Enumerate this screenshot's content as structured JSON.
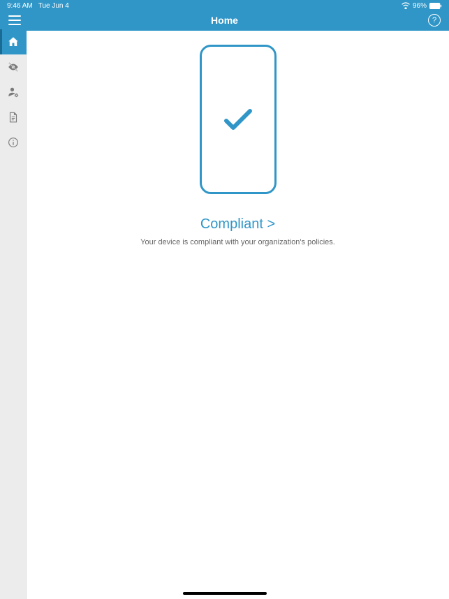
{
  "statusBar": {
    "time": "9:46 AM",
    "date": "Tue Jun 4",
    "battery": "96%"
  },
  "header": {
    "title": "Home",
    "helpSymbol": "?"
  },
  "sidebar": {
    "items": [
      {
        "name": "home",
        "active": true
      },
      {
        "name": "privacy",
        "active": false
      },
      {
        "name": "user-settings",
        "active": false
      },
      {
        "name": "document",
        "active": false
      },
      {
        "name": "info",
        "active": false
      }
    ]
  },
  "main": {
    "statusLabel": "Compliant >",
    "statusDescription": "Your device is compliant with your organization's policies."
  },
  "colors": {
    "primary": "#3096c7",
    "sidebarBg": "#ececec",
    "textMuted": "#666"
  }
}
